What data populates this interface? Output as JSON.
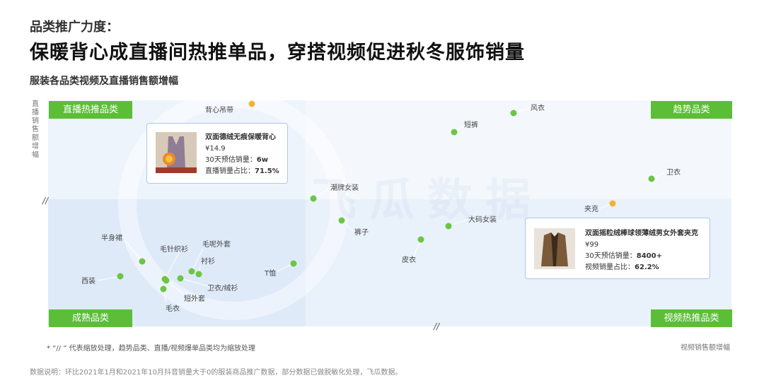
{
  "header": {
    "kicker": "品类推广力度：",
    "headline": "保暖背心成直播间热推单品，穿搭视频促进秋冬服饰销量",
    "subtitle": "服装各品类视频及直播销售额增幅"
  },
  "chart_data": {
    "type": "scatter",
    "title": "服装各品类视频及直播销售额增幅",
    "xlabel": "视频销售额增幅",
    "ylabel": "直播销售额增幅",
    "quadrants": [
      "直播热推品类",
      "趋势品类",
      "成熟品类",
      "视频热推品类"
    ],
    "axis_break_mark": "//",
    "points": [
      {
        "name": "背心吊带",
        "highlight": true
      },
      {
        "name": "风衣",
        "highlight": false
      },
      {
        "name": "短裤",
        "highlight": false
      },
      {
        "name": "卫衣",
        "highlight": false
      },
      {
        "name": "潮牌女装",
        "highlight": false
      },
      {
        "name": "夹克",
        "highlight": true
      },
      {
        "name": "大码女装",
        "highlight": false
      },
      {
        "name": "裤子",
        "highlight": false
      },
      {
        "name": "皮衣",
        "highlight": false
      },
      {
        "name": "T恤",
        "highlight": false
      },
      {
        "name": "半身裙",
        "highlight": false
      },
      {
        "name": "毛针织衫",
        "highlight": false
      },
      {
        "name": "毛呢外套",
        "highlight": false
      },
      {
        "name": "衬衫",
        "highlight": false
      },
      {
        "name": "西装",
        "highlight": false
      },
      {
        "name": "卫衣/绒衫",
        "highlight": false
      },
      {
        "name": "短外套",
        "highlight": false
      },
      {
        "name": "毛衣",
        "highlight": false
      }
    ]
  },
  "cards": {
    "vest": {
      "name": "双面德绒无痕保暖背心",
      "price": "¥14.9",
      "sales_label": "30天预估销量：",
      "sales_value": "6w",
      "share_label": "直播销量占比：",
      "share_value": "71.5%"
    },
    "jacket": {
      "name": "双面摇粒绒棒球领薄绒男女外套夹克",
      "price": "¥99",
      "sales_label": "30天预估销量：",
      "sales_value": "8400+",
      "share_label": "视频销量占比：",
      "share_value": "62.2%"
    }
  },
  "watermark": "飞瓜数据",
  "footer": {
    "note": "*  “// ” 代表缩放处理，趋势品类、直播/视频爆单品类均为缩放处理",
    "source": "数据说明：环比2021年1月和2021年10月抖音销量大于0的服装商品推广数据，部分数据已做脱敏化处理，飞瓜数据。"
  },
  "colors": {
    "point": "#6cc644",
    "highlight": "#f5b335",
    "quad_label_bg": "#5cbe37",
    "card_border": "#a9c8ee",
    "quad_light": "#f1f6fd",
    "quad_mid": "#e6effb",
    "quad_dark": "#dce8f8"
  }
}
